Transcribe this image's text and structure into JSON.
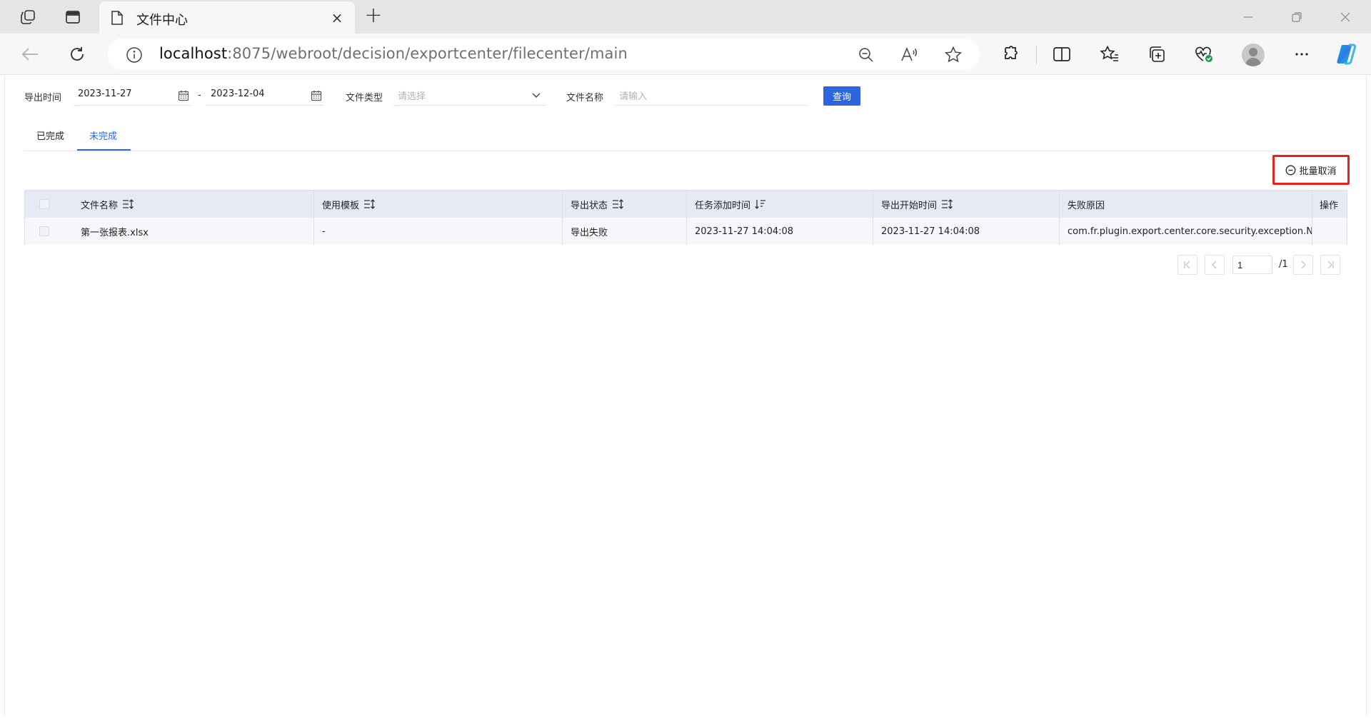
{
  "browser": {
    "tab_title": "文件中心",
    "new_tab": "+",
    "close_tab": "×",
    "url_host": "localhost",
    "url_path": ":8075/webroot/decision/exportcenter/filecenter/main"
  },
  "filters": {
    "export_time_label": "导出时间",
    "date_from": "2023-11-27",
    "date_separator": "-",
    "date_to": "2023-12-04",
    "file_type_label": "文件类型",
    "file_type_placeholder": "请选择",
    "file_name_label": "文件名称",
    "file_name_placeholder": "请输入",
    "search_button": "查询"
  },
  "tabs": [
    {
      "label": "已完成",
      "active": false
    },
    {
      "label": "未完成",
      "active": true
    }
  ],
  "batch_cancel": "批量取消",
  "table": {
    "columns": [
      "文件名称",
      "使用模板",
      "导出状态",
      "任务添加时间",
      "导出开始时间",
      "失败原因",
      "操作"
    ],
    "rows": [
      [
        "第一张报表.xlsx",
        "-",
        "导出失败",
        "2023-11-27 14:04:08",
        "2023-11-27 14:04:08",
        "com.fr.plugin.export.center.core.security.exception.NoUs",
        ""
      ]
    ]
  },
  "pager": {
    "current_page": "1",
    "total": "/1"
  },
  "colors": {
    "accent": "#2e64e0",
    "highlight_border": "#e52222",
    "table_header_bg": "#e6ebf3"
  }
}
